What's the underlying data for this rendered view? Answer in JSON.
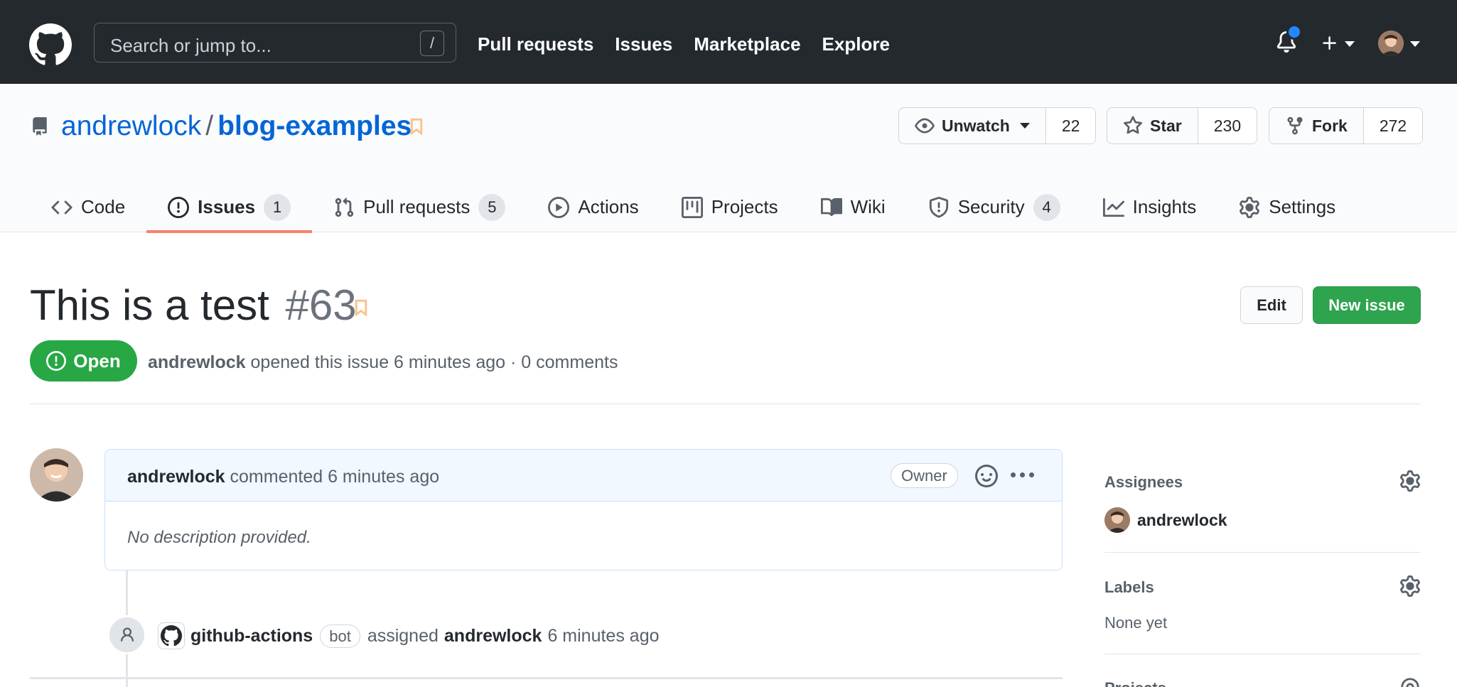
{
  "header": {
    "search_placeholder": "Search or jump to...",
    "search_shortcut": "/",
    "nav": [
      "Pull requests",
      "Issues",
      "Marketplace",
      "Explore"
    ]
  },
  "repo": {
    "owner": "andrewlock",
    "separator": "/",
    "name": "blog-examples",
    "watch": {
      "label": "Unwatch",
      "count": "22"
    },
    "star": {
      "label": "Star",
      "count": "230"
    },
    "fork": {
      "label": "Fork",
      "count": "272"
    },
    "tabs": [
      {
        "label": "Code",
        "icon": "code-icon"
      },
      {
        "label": "Issues",
        "count": "1",
        "icon": "issue-opened-icon",
        "selected": true
      },
      {
        "label": "Pull requests",
        "count": "5",
        "icon": "git-pull-request-icon"
      },
      {
        "label": "Actions",
        "icon": "play-icon"
      },
      {
        "label": "Projects",
        "icon": "project-icon"
      },
      {
        "label": "Wiki",
        "icon": "book-icon"
      },
      {
        "label": "Security",
        "count": "4",
        "icon": "shield-icon"
      },
      {
        "label": "Insights",
        "icon": "graph-icon"
      },
      {
        "label": "Settings",
        "icon": "gear-icon"
      }
    ]
  },
  "issue": {
    "title": "This is a test",
    "number": "#63",
    "edit_label": "Edit",
    "new_issue_label": "New issue",
    "state": "Open",
    "author": "andrewlock",
    "meta_text": "opened this issue 6 minutes ago · 0 comments"
  },
  "comment": {
    "author": "andrewlock",
    "action": "commented 6 minutes ago",
    "role_badge": "Owner",
    "body": "No description provided."
  },
  "event": {
    "actor": "github-actions",
    "actor_badge": "bot",
    "verb": "assigned",
    "target": "andrewlock",
    "time": "6 minutes ago"
  },
  "sidebar": {
    "assignees": {
      "heading": "Assignees",
      "user": "andrewlock"
    },
    "labels": {
      "heading": "Labels",
      "value": "None yet"
    },
    "projects": {
      "heading": "Projects"
    }
  },
  "colors": {
    "header_bg": "#24292e",
    "link": "#0366d6",
    "open_green": "#28a745",
    "tab_underline": "#f9826c",
    "notification_dot": "#2188ff"
  }
}
